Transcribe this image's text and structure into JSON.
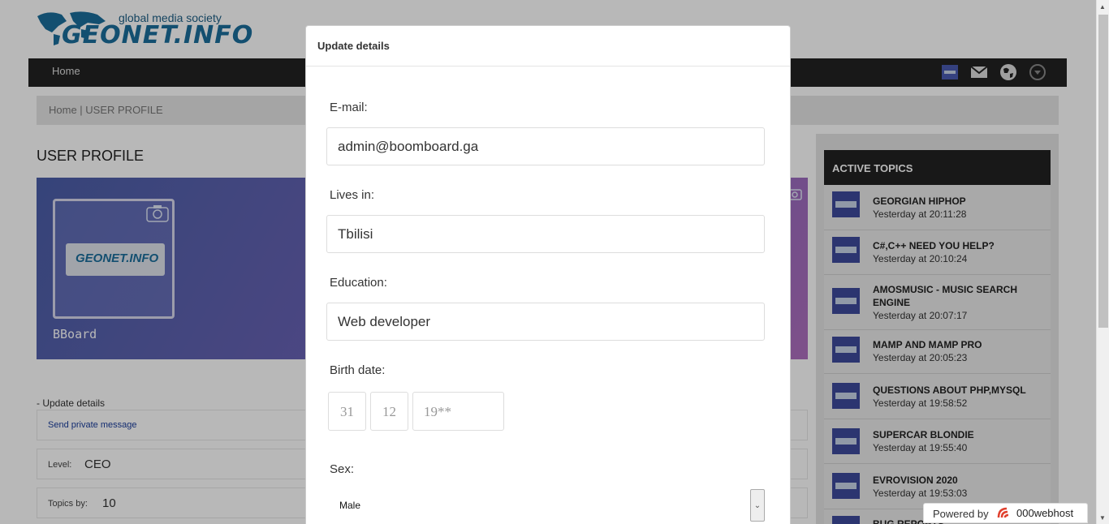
{
  "site": {
    "tagline": "global media society",
    "brand": "GEONET.INFO"
  },
  "nav": {
    "home": "Home",
    "icons": [
      "profile-thumb-icon",
      "mail-icon",
      "globe-icon",
      "dropdown-circle-icon"
    ]
  },
  "breadcrumb": "Home | USER PROFILE",
  "profile": {
    "heading": "USER PROFILE",
    "username": "BBoard",
    "avatar_brand": "GEONET.INFO",
    "update_link": "- Update details",
    "send_message": "Send private message",
    "level_label": "Level:",
    "level_value": "CEO",
    "topics_label": "Topics by:",
    "topics_value": "10"
  },
  "sidebar": {
    "heading": "ACTIVE TOPICS",
    "topics": [
      {
        "title": "GEORGIAN HIPHOP",
        "date": "Yesterday at 20:11:28"
      },
      {
        "title": "C#,C++ NEED YOU HELP?",
        "date": "Yesterday at 20:10:24"
      },
      {
        "title": "AMOSMUSIC - MUSIC SEARCH ENGINE",
        "date": "Yesterday at 20:07:17"
      },
      {
        "title": "MAMP AND MAMP PRO",
        "date": "Yesterday at 20:05:23"
      },
      {
        "title": "QUESTIONS ABOUT PHP,MYSQL",
        "date": "Yesterday at 19:58:52"
      },
      {
        "title": "SUPERCAR BLONDIE",
        "date": "Yesterday at 19:55:40"
      },
      {
        "title": "EVROVISION 2020",
        "date": "Yesterday at 19:53:03"
      },
      {
        "title": "BUG REPORTS",
        "date": ""
      }
    ]
  },
  "modal": {
    "title": "Update details",
    "email_label": "E-mail:",
    "email_value": "admin@boomboard.ga",
    "lives_label": "Lives in:",
    "lives_value": "Tbilisi",
    "education_label": "Education:",
    "education_value": "Web developer",
    "birth_label": "Birth date:",
    "birth_day": "31",
    "birth_month": "12",
    "birth_year": "19**",
    "sex_label": "Sex:",
    "sex_value": "Male"
  },
  "powered": {
    "label": "Powered by",
    "host": "000webhost"
  },
  "colors": {
    "navbar": "#222222",
    "accent_link": "#1a3d9c",
    "brand_blue": "#1b6e9c"
  }
}
